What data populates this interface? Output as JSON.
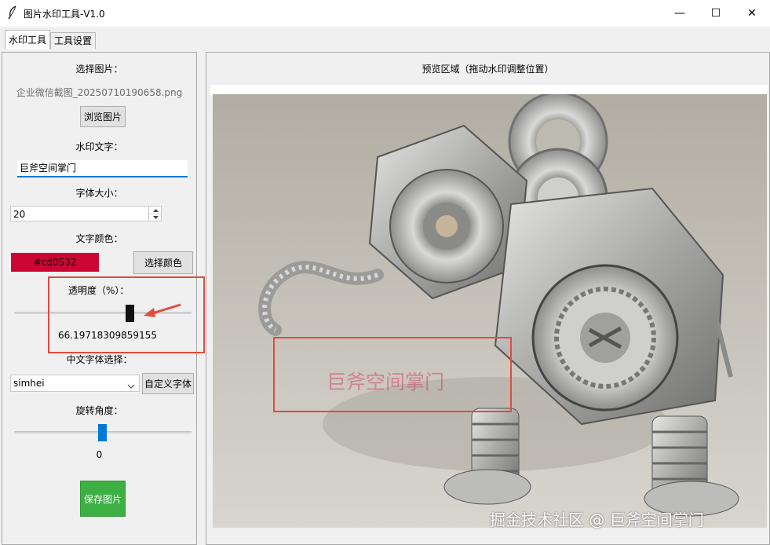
{
  "window": {
    "title": "图片水印工具-V1.0",
    "minimize_glyph": "—",
    "maximize_glyph": "☐",
    "close_glyph": "✕"
  },
  "tabs": [
    {
      "label": "水印工具",
      "active": true
    },
    {
      "label": "工具设置",
      "active": false
    }
  ],
  "left": {
    "select_image_label": "选择图片：",
    "image_filename": "企业微信截图_20250710190658.png",
    "browse_button": "浏览图片",
    "watermark_text_label": "水印文字：",
    "watermark_text_value": "巨斧空间掌门",
    "font_size_label": "字体大小：",
    "font_size_value": "20",
    "text_color_label": "文字颜色：",
    "text_color_value": "#cd0532",
    "choose_color_button": "选择颜色",
    "opacity_label": "透明度（%）：",
    "opacity_value": "66.19718309859155",
    "chinese_font_label": "中文字体选择：",
    "chinese_font_value": "simhei",
    "custom_font_button": "自定义字体",
    "rotation_label": "旋转角度：",
    "rotation_value": "0",
    "save_button": "保存图片"
  },
  "right": {
    "preview_title": "预览区域（拖动水印调整位置）",
    "watermark_overlay_text": "巨斧空间掌门",
    "credit_text": "掘金技术社区 @ 巨斧空间掌门"
  },
  "colors": {
    "swatch": "#cd0532",
    "save_button_bg": "#3cb043",
    "annotation_red": "#e04b3e",
    "slider_thumb_blue": "#0078d7"
  }
}
